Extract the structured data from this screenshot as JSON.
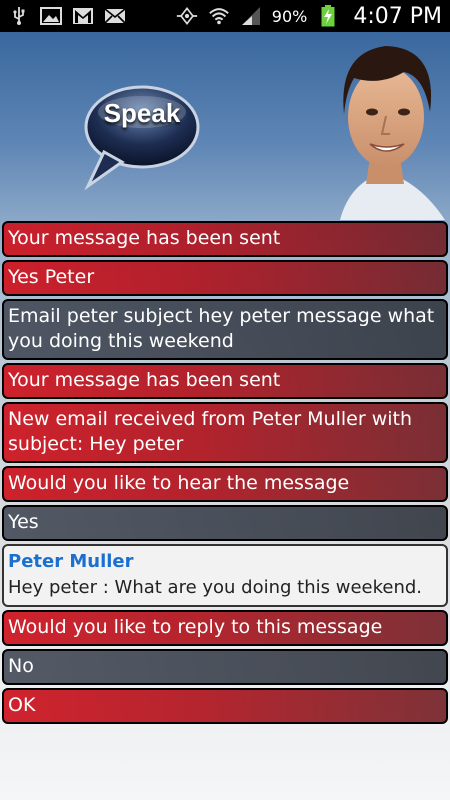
{
  "status_bar": {
    "battery_percent": "90%",
    "time": "4:07 PM",
    "left_icons": [
      "usb-icon",
      "image-icon",
      "gmail-icon",
      "email-icon"
    ],
    "right_icons": [
      "sync-icon",
      "wifi-icon",
      "signal-icon",
      "battery-charging-icon"
    ]
  },
  "header": {
    "speak_label": "Speak"
  },
  "messages": [
    {
      "type": "red",
      "text": "Your message has been sent"
    },
    {
      "type": "red",
      "text": "Yes Peter"
    },
    {
      "type": "dark",
      "text": "Email peter subject hey peter message what you doing this weekend"
    },
    {
      "type": "red",
      "text": "Your message has been sent"
    },
    {
      "type": "red",
      "text": "New email received from Peter Muller with subject: Hey peter"
    },
    {
      "type": "red",
      "text": "Would you like to hear the message"
    },
    {
      "type": "dark",
      "text": "Yes"
    },
    {
      "type": "email",
      "from": "Peter Muller",
      "body": "Hey peter : What are you doing this weekend."
    },
    {
      "type": "red",
      "text": "Would you like to reply to this message"
    },
    {
      "type": "dark",
      "text": "No"
    },
    {
      "type": "red",
      "text": "OK"
    }
  ],
  "colors": {
    "red_bubble": "#c8161f",
    "dark_bubble": "#444a55",
    "email_sender": "#1b6fd0",
    "status_bar": "#000000"
  }
}
